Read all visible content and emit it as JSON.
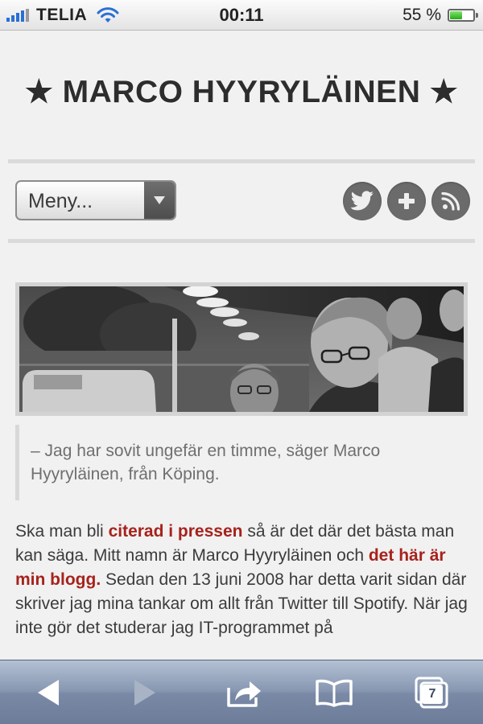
{
  "status_bar": {
    "carrier": "TELIA",
    "time": "00:11",
    "battery_percent": "55 %",
    "battery_level": 0.55,
    "signal_icon": "signal-bars-icon",
    "wifi_icon": "wifi-icon"
  },
  "site": {
    "title": "★ MARCO HYYRYLÄINEN ★"
  },
  "nav": {
    "menu_label": "Meny...",
    "social_icons": [
      "twitter-icon",
      "google-plus-icon",
      "rss-icon"
    ]
  },
  "article": {
    "quote": "– Jag har sovit ungefär en timme, säger Marco Hyyryläinen, från Köping.",
    "p1_a": "Ska man bli ",
    "link1": "citerad i pressen",
    "p1_b": " så är det där det bästa man kan säga. Mitt namn är Marco Hyyryläinen och ",
    "link2": "det här är min blogg.",
    "p1_c": " Sedan den 13 juni 2008 har detta varit sidan där skriver jag mina tankar om allt från Twitter till Spotify. När jag inte gör det studerar jag IT-programmet på"
  },
  "toolbar": {
    "tab_count": "7",
    "icons": [
      "back-arrow-icon",
      "forward-arrow-icon",
      "share-icon",
      "bookmarks-icon",
      "tabs-icon"
    ]
  },
  "colors": {
    "link": "#a7221c",
    "signal": "#2a6fd6",
    "toolbar": "#7a8aa6"
  }
}
